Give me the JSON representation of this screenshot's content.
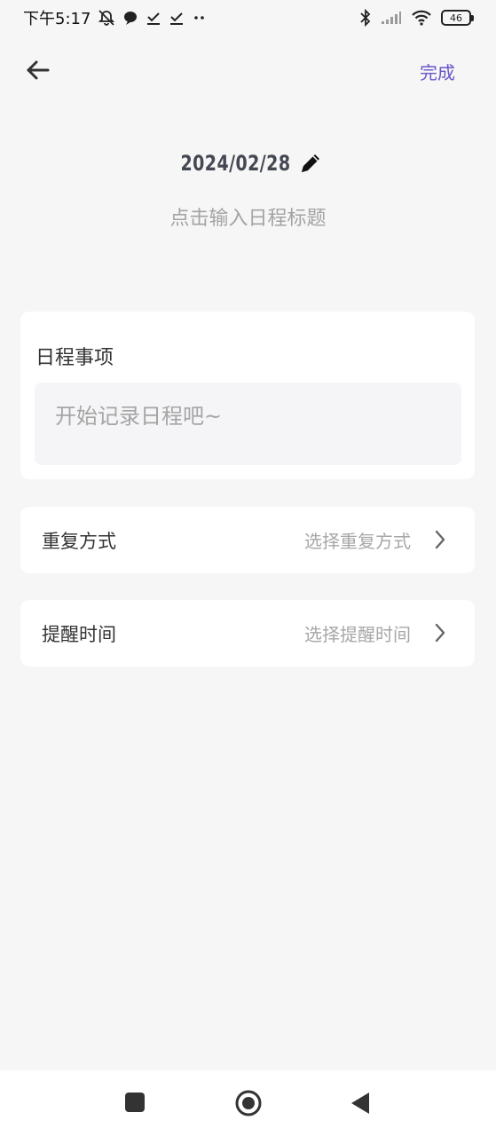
{
  "status_bar": {
    "time": "下午5:17",
    "battery": "46",
    "icons": [
      "bell-off-icon",
      "chat-bubble-icon",
      "check-icon",
      "check-icon",
      "more-dots-icon",
      "bluetooth-icon",
      "signal-icon",
      "wifi-icon",
      "battery-icon"
    ]
  },
  "header": {
    "done_label": "完成",
    "back_icon": "arrow-left-icon"
  },
  "schedule": {
    "date": "2024/02/28",
    "title_placeholder": "点击输入日程标题",
    "edit_icon": "pencil-icon"
  },
  "notes": {
    "label": "日程事项",
    "placeholder": "开始记录日程吧~"
  },
  "repeat": {
    "label": "重复方式",
    "value": "选择重复方式"
  },
  "reminder": {
    "label": "提醒时间",
    "value": "选择提醒时间"
  },
  "colors": {
    "accent": "#6a55c9",
    "background": "#f6f6f6",
    "card": "#ffffff",
    "placeholder": "#a5a5a5"
  }
}
